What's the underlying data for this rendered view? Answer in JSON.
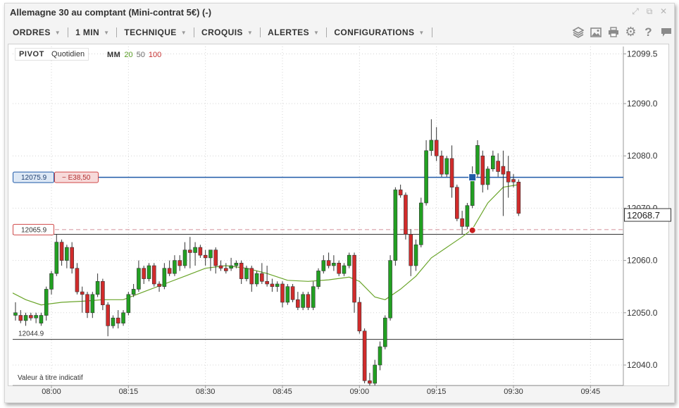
{
  "window": {
    "title": "Allemagne 30 au comptant (Mini-contrat 5€) (-)",
    "icons": [
      "expand-icon",
      "popout-icon",
      "close-icon"
    ]
  },
  "toolbar": {
    "menus": [
      {
        "label": "ORDRES"
      },
      {
        "label": "1 MIN"
      },
      {
        "label": "TECHNIQUE"
      },
      {
        "label": "CROQUIS"
      },
      {
        "label": "ALERTES"
      },
      {
        "label": "CONFIGURATIONS"
      }
    ],
    "tools": [
      "layers-icon",
      "image-icon",
      "print-icon",
      "settings-icon",
      "help-icon",
      "comment-icon"
    ]
  },
  "legend": {
    "pivot_label": "PIVOT",
    "pivot_period": "Quotidien",
    "ma_label": "MM",
    "ma_periods": [
      "20",
      "50",
      "100"
    ]
  },
  "price_lines": {
    "order_level": "12075.9",
    "order_pnl": "− E38,50",
    "stop_level": "12065.9",
    "low_level": "12044.9",
    "current_price": "12068.7"
  },
  "notice": "Valeur à titre indicatif",
  "colors": {
    "up": "#22a022",
    "down": "#d12b2b",
    "ma": "#6aa52a",
    "order_line": "#1f5aa8",
    "stop_line": "#d9a0a8"
  },
  "chart_data": {
    "type": "candlestick",
    "y_axis_labels": [
      "12099.5",
      "12090.0",
      "12080.0",
      "12070.0",
      "12060.0",
      "12050.0",
      "12040.0"
    ],
    "x_axis_labels": [
      "08:00",
      "08:15",
      "08:30",
      "08:45",
      "09:00",
      "09:15",
      "09:30",
      "09:45"
    ],
    "ylim": [
      12036.0,
      12100.5
    ],
    "xlim": [
      "07:53",
      "09:48"
    ],
    "candles": [
      {
        "t": "07:52",
        "o": 12055.0,
        "h": 12056.5,
        "l": 12052.0,
        "c": 12053.5
      },
      {
        "t": "07:53",
        "o": 12049.5,
        "h": 12052.0,
        "l": 12048.5,
        "c": 12050.0
      },
      {
        "t": "07:54",
        "o": 12049.5,
        "h": 12050.5,
        "l": 12048.0,
        "c": 12048.5
      },
      {
        "t": "07:55",
        "o": 12048.5,
        "h": 12050.0,
        "l": 12047.5,
        "c": 12049.5
      },
      {
        "t": "07:56",
        "o": 12049.5,
        "h": 12050.0,
        "l": 12048.5,
        "c": 12049.0
      },
      {
        "t": "07:57",
        "o": 12049.0,
        "h": 12050.0,
        "l": 12048.0,
        "c": 12049.5
      },
      {
        "t": "07:58",
        "o": 12048.0,
        "h": 12050.0,
        "l": 12047.5,
        "c": 12049.5
      },
      {
        "t": "07:59",
        "o": 12049.5,
        "h": 12055.0,
        "l": 12048.5,
        "c": 12054.5
      },
      {
        "t": "08:00",
        "o": 12054.5,
        "h": 12058.0,
        "l": 12053.5,
        "c": 12057.5
      },
      {
        "t": "08:01",
        "o": 12057.5,
        "h": 12065.0,
        "l": 12057.0,
        "c": 12063.5
      },
      {
        "t": "08:02",
        "o": 12063.5,
        "h": 12064.0,
        "l": 12059.0,
        "c": 12060.0
      },
      {
        "t": "08:03",
        "o": 12060.0,
        "h": 12063.0,
        "l": 12058.5,
        "c": 12062.5
      },
      {
        "t": "08:04",
        "o": 12062.5,
        "h": 12063.5,
        "l": 12057.5,
        "c": 12058.5
      },
      {
        "t": "08:05",
        "o": 12058.5,
        "h": 12059.5,
        "l": 12053.5,
        "c": 12054.0
      },
      {
        "t": "08:06",
        "o": 12054.0,
        "h": 12055.0,
        "l": 12050.0,
        "c": 12053.5
      },
      {
        "t": "08:07",
        "o": 12053.5,
        "h": 12054.0,
        "l": 12049.0,
        "c": 12050.0
      },
      {
        "t": "08:08",
        "o": 12050.0,
        "h": 12054.0,
        "l": 12049.0,
        "c": 12053.5
      },
      {
        "t": "08:09",
        "o": 12053.5,
        "h": 12057.5,
        "l": 12053.0,
        "c": 12056.0
      },
      {
        "t": "08:10",
        "o": 12056.0,
        "h": 12056.5,
        "l": 12050.5,
        "c": 12051.5
      },
      {
        "t": "08:11",
        "o": 12051.5,
        "h": 12052.0,
        "l": 12045.5,
        "c": 12047.5
      },
      {
        "t": "08:12",
        "o": 12047.5,
        "h": 12049.5,
        "l": 12047.0,
        "c": 12049.0
      },
      {
        "t": "08:13",
        "o": 12049.0,
        "h": 12050.5,
        "l": 12047.0,
        "c": 12048.0
      },
      {
        "t": "08:14",
        "o": 12048.0,
        "h": 12050.5,
        "l": 12047.5,
        "c": 12050.0
      },
      {
        "t": "08:15",
        "o": 12050.0,
        "h": 12054.0,
        "l": 12049.5,
        "c": 12053.5
      },
      {
        "t": "08:16",
        "o": 12053.5,
        "h": 12055.5,
        "l": 12053.0,
        "c": 12054.5
      },
      {
        "t": "08:17",
        "o": 12054.5,
        "h": 12060.0,
        "l": 12054.0,
        "c": 12058.5
      },
      {
        "t": "08:18",
        "o": 12058.5,
        "h": 12059.0,
        "l": 12055.5,
        "c": 12056.5
      },
      {
        "t": "08:19",
        "o": 12056.5,
        "h": 12059.5,
        "l": 12056.0,
        "c": 12059.0
      },
      {
        "t": "08:20",
        "o": 12059.0,
        "h": 12059.5,
        "l": 12055.0,
        "c": 12055.5
      },
      {
        "t": "08:21",
        "o": 12055.5,
        "h": 12056.0,
        "l": 12054.0,
        "c": 12055.0
      },
      {
        "t": "08:22",
        "o": 12055.0,
        "h": 12059.5,
        "l": 12054.5,
        "c": 12058.5
      },
      {
        "t": "08:23",
        "o": 12058.5,
        "h": 12060.0,
        "l": 12057.0,
        "c": 12057.5
      },
      {
        "t": "08:24",
        "o": 12057.5,
        "h": 12061.0,
        "l": 12057.0,
        "c": 12060.0
      },
      {
        "t": "08:25",
        "o": 12060.0,
        "h": 12061.0,
        "l": 12058.0,
        "c": 12059.0
      },
      {
        "t": "08:26",
        "o": 12059.0,
        "h": 12063.5,
        "l": 12058.5,
        "c": 12062.0
      },
      {
        "t": "08:27",
        "o": 12062.0,
        "h": 12064.5,
        "l": 12058.5,
        "c": 12061.5
      },
      {
        "t": "08:28",
        "o": 12061.5,
        "h": 12063.5,
        "l": 12059.0,
        "c": 12062.5
      },
      {
        "t": "08:29",
        "o": 12062.5,
        "h": 12063.0,
        "l": 12060.5,
        "c": 12061.0
      },
      {
        "t": "08:30",
        "o": 12061.0,
        "h": 12062.0,
        "l": 12059.0,
        "c": 12060.5
      },
      {
        "t": "08:31",
        "o": 12060.5,
        "h": 12062.0,
        "l": 12058.0,
        "c": 12062.0
      },
      {
        "t": "08:32",
        "o": 12062.0,
        "h": 12062.5,
        "l": 12057.5,
        "c": 12059.0
      },
      {
        "t": "08:33",
        "o": 12059.0,
        "h": 12060.0,
        "l": 12058.0,
        "c": 12058.5
      },
      {
        "t": "08:34",
        "o": 12058.5,
        "h": 12059.5,
        "l": 12057.5,
        "c": 12058.0
      },
      {
        "t": "08:35",
        "o": 12058.5,
        "h": 12060.5,
        "l": 12058.0,
        "c": 12059.0
      },
      {
        "t": "08:36",
        "o": 12059.0,
        "h": 12060.0,
        "l": 12058.5,
        "c": 12059.5
      },
      {
        "t": "08:37",
        "o": 12059.5,
        "h": 12060.0,
        "l": 12055.5,
        "c": 12056.5
      },
      {
        "t": "08:38",
        "o": 12056.5,
        "h": 12059.0,
        "l": 12056.0,
        "c": 12058.5
      },
      {
        "t": "08:39",
        "o": 12058.5,
        "h": 12059.0,
        "l": 12054.0,
        "c": 12055.5
      },
      {
        "t": "08:40",
        "o": 12055.5,
        "h": 12058.0,
        "l": 12055.0,
        "c": 12057.5
      },
      {
        "t": "08:41",
        "o": 12057.5,
        "h": 12059.5,
        "l": 12055.5,
        "c": 12056.0
      },
      {
        "t": "08:42",
        "o": 12056.0,
        "h": 12059.0,
        "l": 12055.0,
        "c": 12055.5
      },
      {
        "t": "08:43",
        "o": 12055.5,
        "h": 12056.5,
        "l": 12054.0,
        "c": 12055.0
      },
      {
        "t": "08:44",
        "o": 12055.0,
        "h": 12056.0,
        "l": 12054.0,
        "c": 12055.5
      },
      {
        "t": "08:45",
        "o": 12055.5,
        "h": 12056.0,
        "l": 12051.0,
        "c": 12052.0
      },
      {
        "t": "08:46",
        "o": 12052.0,
        "h": 12055.5,
        "l": 12051.5,
        "c": 12055.0
      },
      {
        "t": "08:47",
        "o": 12055.0,
        "h": 12055.5,
        "l": 12052.0,
        "c": 12052.5
      },
      {
        "t": "08:48",
        "o": 12052.5,
        "h": 12054.0,
        "l": 12050.5,
        "c": 12051.0
      },
      {
        "t": "08:49",
        "o": 12051.0,
        "h": 12054.0,
        "l": 12050.5,
        "c": 12053.5
      },
      {
        "t": "08:50",
        "o": 12053.5,
        "h": 12054.0,
        "l": 12050.5,
        "c": 12051.0
      },
      {
        "t": "08:51",
        "o": 12051.0,
        "h": 12056.0,
        "l": 12050.5,
        "c": 12055.0
      },
      {
        "t": "08:52",
        "o": 12055.0,
        "h": 12058.5,
        "l": 12054.5,
        "c": 12058.0
      },
      {
        "t": "08:53",
        "o": 12058.0,
        "h": 12061.0,
        "l": 12057.5,
        "c": 12060.0
      },
      {
        "t": "08:54",
        "o": 12060.0,
        "h": 12061.5,
        "l": 12058.5,
        "c": 12059.0
      },
      {
        "t": "08:55",
        "o": 12059.0,
        "h": 12061.0,
        "l": 12058.0,
        "c": 12059.5
      },
      {
        "t": "08:56",
        "o": 12059.5,
        "h": 12060.0,
        "l": 12057.0,
        "c": 12057.5
      },
      {
        "t": "08:57",
        "o": 12057.5,
        "h": 12059.5,
        "l": 12057.0,
        "c": 12059.0
      },
      {
        "t": "08:58",
        "o": 12059.0,
        "h": 12061.5,
        "l": 12058.5,
        "c": 12061.0
      },
      {
        "t": "08:59",
        "o": 12061.0,
        "h": 12061.5,
        "l": 12050.0,
        "c": 12052.0
      },
      {
        "t": "09:00",
        "o": 12052.0,
        "h": 12053.0,
        "l": 12046.0,
        "c": 12046.5
      },
      {
        "t": "09:01",
        "o": 12046.5,
        "h": 12047.0,
        "l": 12036.5,
        "c": 12037.0
      },
      {
        "t": "09:02",
        "o": 12037.0,
        "h": 12038.5,
        "l": 12036.0,
        "c": 12036.5
      },
      {
        "t": "09:03",
        "o": 12036.5,
        "h": 12041.0,
        "l": 12036.0,
        "c": 12040.0
      },
      {
        "t": "09:04",
        "o": 12040.0,
        "h": 12044.5,
        "l": 12039.0,
        "c": 12043.5
      },
      {
        "t": "09:05",
        "o": 12043.5,
        "h": 12049.5,
        "l": 12043.0,
        "c": 12049.0
      },
      {
        "t": "09:06",
        "o": 12049.0,
        "h": 12061.0,
        "l": 12048.5,
        "c": 12060.0
      },
      {
        "t": "09:07",
        "o": 12060.0,
        "h": 12074.0,
        "l": 12059.0,
        "c": 12073.5
      },
      {
        "t": "09:08",
        "o": 12073.5,
        "h": 12074.5,
        "l": 12072.0,
        "c": 12072.5
      },
      {
        "t": "09:09",
        "o": 12072.5,
        "h": 12073.0,
        "l": 12064.0,
        "c": 12065.0
      },
      {
        "t": "09:10",
        "o": 12065.0,
        "h": 12066.0,
        "l": 12057.0,
        "c": 12059.0
      },
      {
        "t": "09:11",
        "o": 12059.0,
        "h": 12064.0,
        "l": 12058.0,
        "c": 12063.0
      },
      {
        "t": "09:12",
        "o": 12063.0,
        "h": 12072.0,
        "l": 12062.5,
        "c": 12071.0
      },
      {
        "t": "09:13",
        "o": 12071.0,
        "h": 12083.0,
        "l": 12070.5,
        "c": 12081.0
      },
      {
        "t": "09:14",
        "o": 12081.0,
        "h": 12087.0,
        "l": 12080.0,
        "c": 12083.0
      },
      {
        "t": "09:15",
        "o": 12083.0,
        "h": 12085.5,
        "l": 12079.0,
        "c": 12080.0
      },
      {
        "t": "09:16",
        "o": 12080.0,
        "h": 12081.0,
        "l": 12076.0,
        "c": 12076.5
      },
      {
        "t": "09:17",
        "o": 12076.5,
        "h": 12080.0,
        "l": 12076.0,
        "c": 12079.5
      },
      {
        "t": "09:18",
        "o": 12079.5,
        "h": 12082.0,
        "l": 12072.0,
        "c": 12074.0
      },
      {
        "t": "09:19",
        "o": 12074.0,
        "h": 12074.5,
        "l": 12067.5,
        "c": 12068.0
      },
      {
        "t": "09:20",
        "o": 12068.0,
        "h": 12069.5,
        "l": 12065.0,
        "c": 12066.5
      },
      {
        "t": "09:21",
        "o": 12066.5,
        "h": 12071.0,
        "l": 12066.0,
        "c": 12070.5
      },
      {
        "t": "09:22",
        "o": 12070.5,
        "h": 12078.0,
        "l": 12070.0,
        "c": 12076.5
      },
      {
        "t": "09:23",
        "o": 12076.5,
        "h": 12083.0,
        "l": 12076.0,
        "c": 12082.0
      },
      {
        "t": "09:24",
        "o": 12080.0,
        "h": 12081.0,
        "l": 12073.0,
        "c": 12074.5
      },
      {
        "t": "09:25",
        "o": 12074.5,
        "h": 12078.0,
        "l": 12073.5,
        "c": 12077.5
      },
      {
        "t": "09:26",
        "o": 12077.5,
        "h": 12081.0,
        "l": 12077.0,
        "c": 12080.0
      },
      {
        "t": "09:27",
        "o": 12079.0,
        "h": 12080.5,
        "l": 12076.0,
        "c": 12077.0
      },
      {
        "t": "09:28",
        "o": 12078.0,
        "h": 12081.0,
        "l": 12068.5,
        "c": 12076.5
      },
      {
        "t": "09:29",
        "o": 12077.0,
        "h": 12080.0,
        "l": 12072.0,
        "c": 12075.0
      },
      {
        "t": "09:30",
        "o": 12075.5,
        "h": 12076.5,
        "l": 12074.0,
        "c": 12075.0
      },
      {
        "t": "09:31",
        "o": 12075.0,
        "h": 12075.5,
        "l": 12068.5,
        "c": 12069.0
      }
    ],
    "series": [
      {
        "name": "MM 20",
        "values": [
          {
            "t": "07:52",
            "v": 12054.0
          },
          {
            "t": "07:55",
            "v": 12052.5
          },
          {
            "t": "07:58",
            "v": 12051.5
          },
          {
            "t": "08:02",
            "v": 12052.0
          },
          {
            "t": "08:06",
            "v": 12052.2
          },
          {
            "t": "08:10",
            "v": 12052.5
          },
          {
            "t": "08:14",
            "v": 12052.5
          },
          {
            "t": "08:18",
            "v": 12054.0
          },
          {
            "t": "08:22",
            "v": 12055.5
          },
          {
            "t": "08:26",
            "v": 12057.0
          },
          {
            "t": "08:30",
            "v": 12058.5
          },
          {
            "t": "08:34",
            "v": 12059.0
          },
          {
            "t": "08:38",
            "v": 12058.5
          },
          {
            "t": "08:42",
            "v": 12057.5
          },
          {
            "t": "08:46",
            "v": 12056.2
          },
          {
            "t": "08:50",
            "v": 12056.0
          },
          {
            "t": "08:54",
            "v": 12056.3
          },
          {
            "t": "08:58",
            "v": 12056.8
          },
          {
            "t": "09:00",
            "v": 12056.0
          },
          {
            "t": "09:03",
            "v": 12053.0
          },
          {
            "t": "09:05",
            "v": 12052.5
          },
          {
            "t": "09:08",
            "v": 12054.5
          },
          {
            "t": "09:11",
            "v": 12057.0
          },
          {
            "t": "09:14",
            "v": 12060.5
          },
          {
            "t": "09:17",
            "v": 12062.5
          },
          {
            "t": "09:20",
            "v": 12064.5
          },
          {
            "t": "09:22",
            "v": 12066.0
          },
          {
            "t": "09:25",
            "v": 12071.0
          },
          {
            "t": "09:28",
            "v": 12074.0
          },
          {
            "t": "09:31",
            "v": 12074.5
          }
        ]
      }
    ],
    "markers": [
      {
        "kind": "order",
        "t": "09:22",
        "v": 12075.9
      },
      {
        "kind": "stop",
        "t": "09:22",
        "v": 12065.9
      }
    ]
  }
}
